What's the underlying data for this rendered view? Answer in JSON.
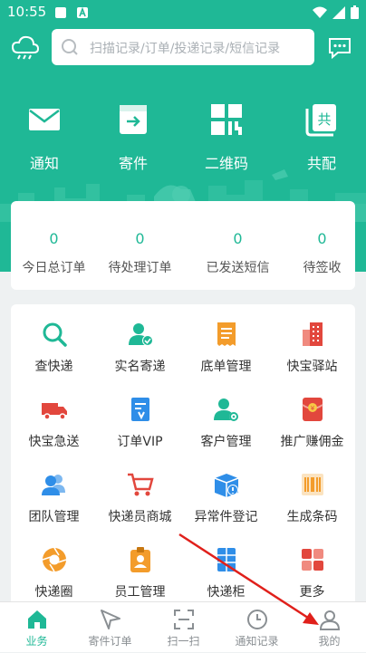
{
  "status_bar": {
    "time": "10:55"
  },
  "search": {
    "placeholder": "扫描记录/订单/投递记录/短信记录"
  },
  "quick_actions": [
    {
      "label": "通知",
      "icon": "mail-icon"
    },
    {
      "label": "寄件",
      "icon": "box-icon"
    },
    {
      "label": "二维码",
      "icon": "qrcode-icon"
    },
    {
      "label": "共配",
      "icon": "shared-delivery-icon"
    }
  ],
  "stats": [
    {
      "value": "0",
      "label": "今日总订单"
    },
    {
      "value": "0",
      "label": "待处理订单"
    },
    {
      "value": "0",
      "label": "已发送短信"
    },
    {
      "value": "0",
      "label": "待签收"
    }
  ],
  "services": [
    {
      "label": "查快递",
      "icon": "search-icon",
      "color": "#1fb896"
    },
    {
      "label": "实名寄递",
      "icon": "verified-user-icon",
      "color": "#1fb896"
    },
    {
      "label": "底单管理",
      "icon": "receipt-icon",
      "color": "#f39c2b"
    },
    {
      "label": "快宝驿站",
      "icon": "building-icon",
      "color": "#e2473d"
    },
    {
      "label": "快宝急送",
      "icon": "truck-icon",
      "color": "#e2473d"
    },
    {
      "label": "订单VIP",
      "icon": "vip-order-icon",
      "color": "#2f8ee8"
    },
    {
      "label": "客户管理",
      "icon": "customer-icon",
      "color": "#1fb896"
    },
    {
      "label": "推广赚佣金",
      "icon": "red-envelope-icon",
      "color": "#e2473d"
    },
    {
      "label": "团队管理",
      "icon": "team-icon",
      "color": "#2f8ee8"
    },
    {
      "label": "快递员商城",
      "icon": "cart-icon",
      "color": "#e2473d"
    },
    {
      "label": "异常件登记",
      "icon": "exception-package-icon",
      "color": "#2f8ee8"
    },
    {
      "label": "生成条码",
      "icon": "barcode-icon",
      "color": "#f39c2b"
    },
    {
      "label": "快递圈",
      "icon": "aperture-icon",
      "color": "#f39c2b"
    },
    {
      "label": "员工管理",
      "icon": "badge-icon",
      "color": "#f39c2b"
    },
    {
      "label": "快递柜",
      "icon": "locker-icon",
      "color": "#2f8ee8"
    },
    {
      "label": "更多",
      "icon": "more-grid-icon",
      "color": "#e2473d"
    }
  ],
  "tabs": [
    {
      "label": "业务",
      "icon": "home-icon",
      "active": true
    },
    {
      "label": "寄件订单",
      "icon": "send-icon",
      "active": false
    },
    {
      "label": "扫一扫",
      "icon": "scan-icon",
      "active": false
    },
    {
      "label": "通知记录",
      "icon": "clock-icon",
      "active": false
    },
    {
      "label": "我的",
      "icon": "user-icon",
      "active": false
    }
  ],
  "colors": {
    "primary": "#1fb896",
    "accent_red": "#e2473d",
    "background": "#eef1f2"
  }
}
